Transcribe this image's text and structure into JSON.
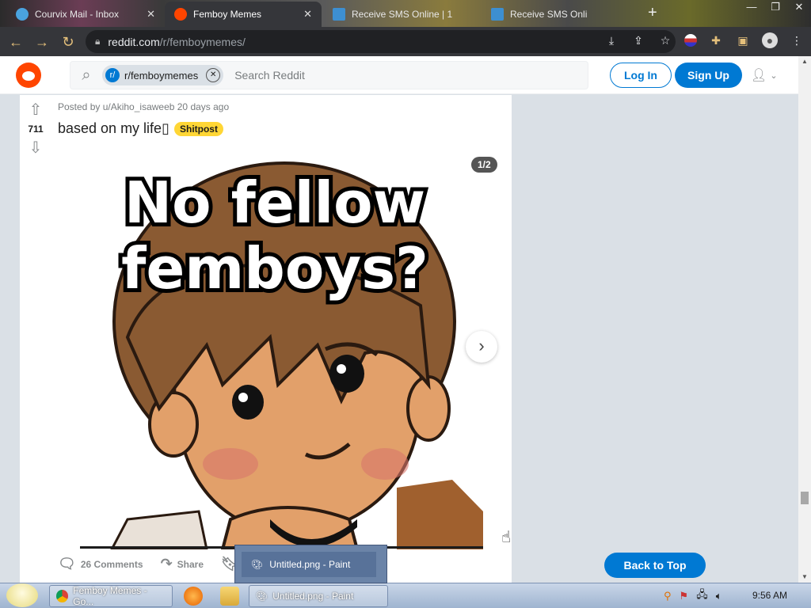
{
  "browser": {
    "tabs": [
      {
        "label": "Courvix Mail - Inbox",
        "active": false
      },
      {
        "label": "Femboy Memes",
        "active": true
      },
      {
        "label": "Receive SMS Online | 1",
        "active": false
      },
      {
        "label": "Receive SMS Onli",
        "active": false
      }
    ],
    "url_host": "reddit.com",
    "url_path": "/r/femboymemes/",
    "new_tab_symbol": "+"
  },
  "reddit": {
    "subreddit_chip": "r/femboymemes",
    "search_placeholder": "Search Reddit",
    "login_label": "Log In",
    "signup_label": "Sign Up",
    "brand_color": "#ff4500",
    "accent_color": "#0079d3"
  },
  "post": {
    "votes": "711",
    "meta": "Posted by u/Akiho_isaweeb 20 days ago",
    "title": "based on my life▯",
    "flair": "Shitpost",
    "flair_color": "#ffd635",
    "gallery_counter": "1/2",
    "image_caption_line1": "No fellow",
    "image_caption_line2": "femboys?",
    "comments_label": "26 Comments",
    "share_label": "Share"
  },
  "page": {
    "back_to_top_label": "Back to Top"
  },
  "taskbar": {
    "tasks": [
      {
        "label": "Femboy Memes - Go..."
      },
      {
        "label": "Untitled.png - Paint"
      }
    ],
    "preview_label": "Untitled.png - Paint",
    "clock": "9:56 AM"
  }
}
